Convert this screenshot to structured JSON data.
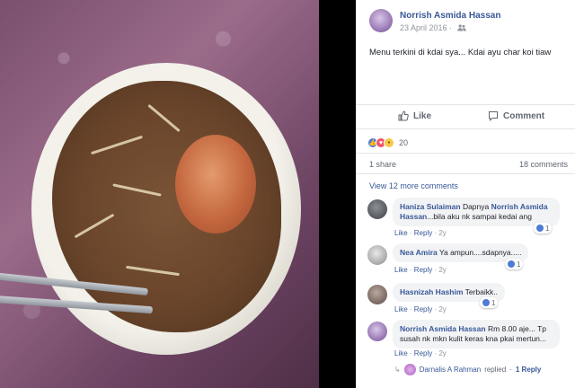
{
  "post": {
    "author": "Norrish Asmida Hassan",
    "date": "23 April 2016",
    "audience_icon": "friends-icon",
    "text": "Menu terkini di kdai sya... Kdai ayu char koi tiaw"
  },
  "actions": {
    "like_label": "Like",
    "comment_label": "Comment"
  },
  "reactions": {
    "count": "20",
    "types": [
      "like",
      "love",
      "wow"
    ]
  },
  "stats": {
    "shares": "1 share",
    "comments": "18 comments"
  },
  "view_more": "View 12 more comments",
  "comments": [
    {
      "name": "Haniza Sulaiman",
      "text": "Dapnya Norrish Asmida Hassan...bila aku nk sampai kedai ang",
      "tagged": "Norrish Asmida Hassan",
      "like": "Like",
      "reply": "Reply",
      "age": "2y",
      "likes": "1"
    },
    {
      "name": "Nea Amira",
      "text": "Ya ampun....sdapnya.....",
      "like": "Like",
      "reply": "Reply",
      "age": "2y",
      "likes": "1"
    },
    {
      "name": "Hasnizah Hashim",
      "text": "Terbaikk..",
      "like": "Like",
      "reply": "Reply",
      "age": "2y",
      "likes": "1"
    },
    {
      "name": "Norrish Asmida Hassan",
      "text": "Rm 8.00 aje... Tp susah nk mkn kulit keras kna pkai mertun...",
      "like": "Like",
      "reply": "Reply",
      "age": "2y",
      "likes": ""
    }
  ],
  "reply_summary": {
    "name": "Darnalis A Rahman",
    "verb": "replied",
    "count": "1 Reply"
  },
  "colors": {
    "link": "#385898",
    "muted": "#90949c",
    "like_blue": "#4f7bd6",
    "love_red": "#f0526c"
  }
}
